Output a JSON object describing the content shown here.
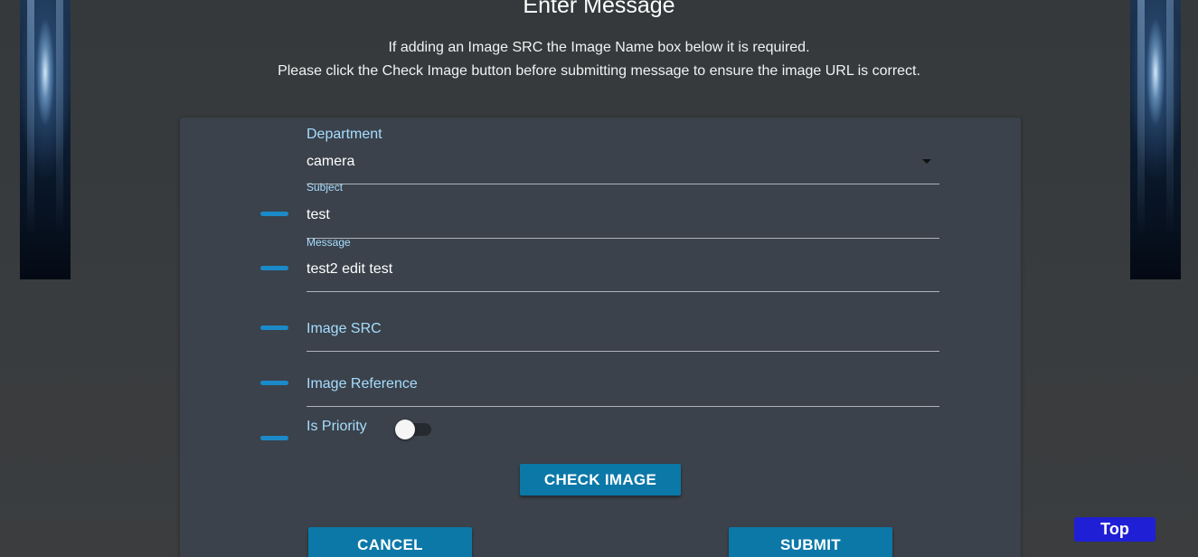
{
  "header": {
    "title": "Enter Message",
    "instruction_line1": "If adding an Image SRC the Image Name box below it is required.",
    "instruction_line2": "Please click the Check Image button before submitting message to ensure the image URL is correct."
  },
  "form": {
    "department": {
      "label": "Department",
      "value": "camera"
    },
    "subject": {
      "label": "Subject",
      "value": "test"
    },
    "message": {
      "label": "Message",
      "value": "test2 edit test"
    },
    "image_src": {
      "label": "Image SRC",
      "value": ""
    },
    "image_reference": {
      "label": "Image Reference",
      "value": ""
    },
    "is_priority": {
      "label": "Is Priority",
      "on": false
    }
  },
  "buttons": {
    "check_image": "CHECK IMAGE",
    "cancel": "CANCEL",
    "submit": "SUBMIT",
    "top": "Top"
  },
  "icons": {
    "field_marker": "dash-icon",
    "dropdown": "caret-down-icon"
  },
  "colors": {
    "accent": "#0b78a8",
    "label": "#a6ddff",
    "marker": "#1b8ac9",
    "top_button": "#1f1fd6",
    "card": "#3b424b"
  }
}
